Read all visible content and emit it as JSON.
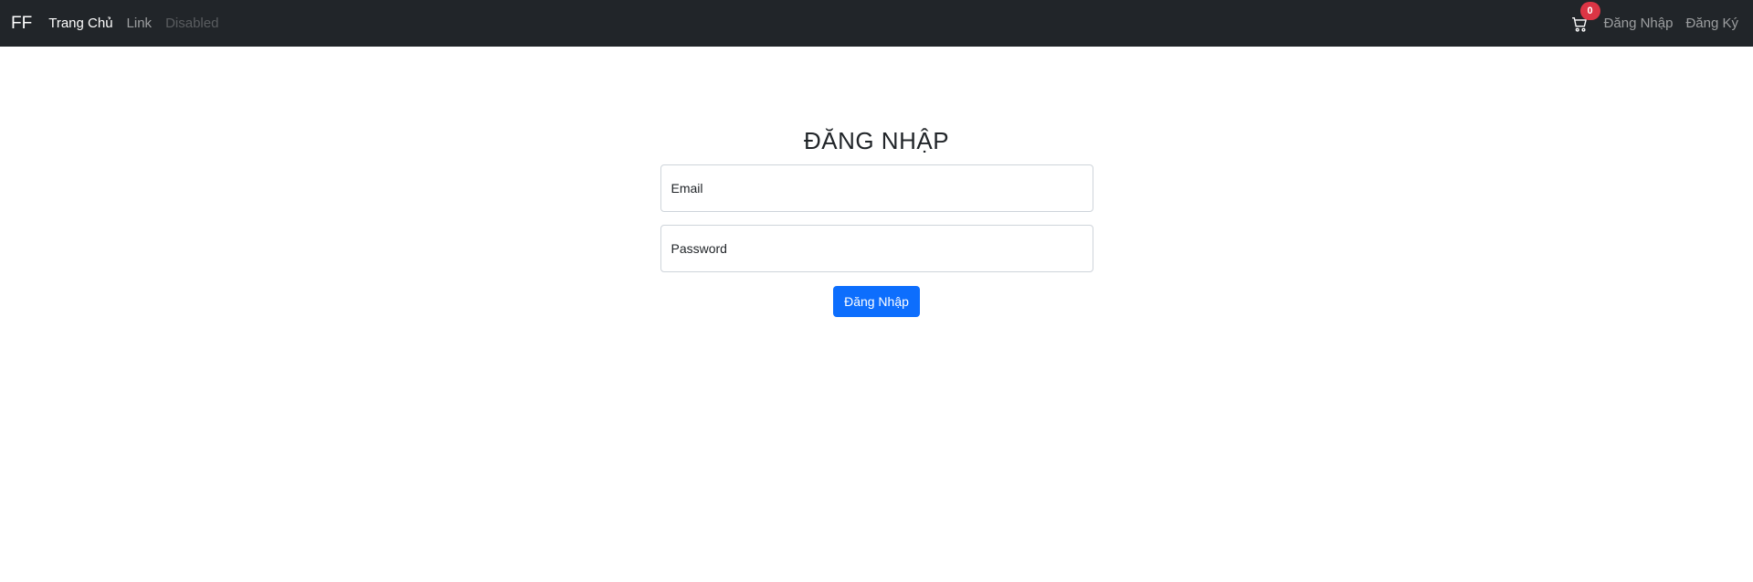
{
  "navbar": {
    "brand": "FF",
    "links": [
      {
        "label": "Trang Chủ",
        "state": "active"
      },
      {
        "label": "Link",
        "state": "normal"
      },
      {
        "label": "Disabled",
        "state": "disabled"
      }
    ],
    "cart": {
      "icon": "cart-icon",
      "count": "0"
    },
    "login_label": "Đăng Nhập",
    "register_label": "Đăng Ký"
  },
  "login_form": {
    "title": "ĐĂNG NHẬP",
    "email": {
      "value": "",
      "placeholder": "Email"
    },
    "password": {
      "value": "",
      "placeholder": "Password"
    },
    "submit_label": "Đăng Nhập"
  },
  "colors": {
    "navbar_bg": "#212529",
    "primary": "#0d6efd",
    "badge": "#dc3545"
  }
}
